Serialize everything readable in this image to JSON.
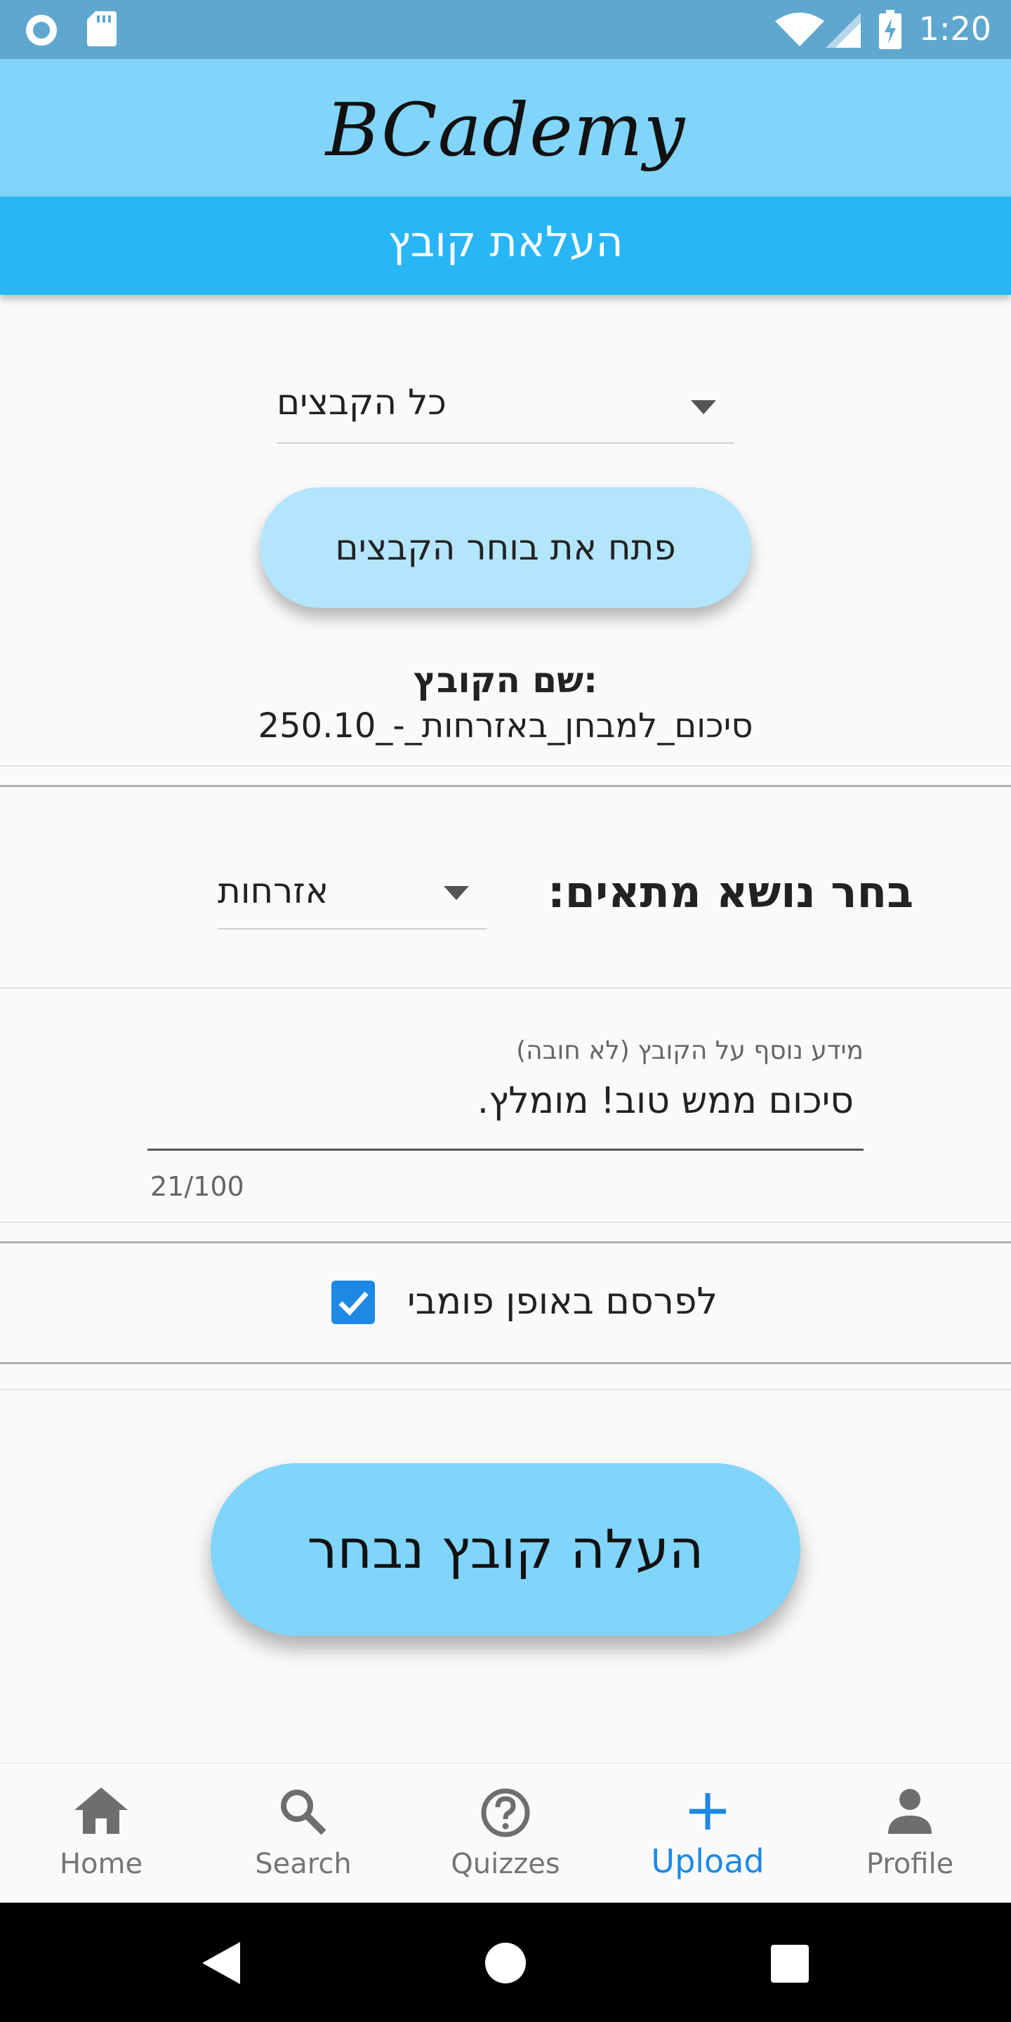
{
  "status_bar": {
    "time": "1:20"
  },
  "app_bar": {
    "title": "BCademy"
  },
  "page": {
    "title": "העלאת קובץ"
  },
  "file_filter": {
    "selected": "כל הקבצים"
  },
  "open_picker": {
    "label": "פתח את בוחר הקבצים"
  },
  "file_info": {
    "name_label": "שם הקובץ:",
    "name_value": "סיכום_למבחן_באזרחות_-_250.10"
  },
  "subject": {
    "label": "בחר נושא מתאים:",
    "selected": "אזרחות"
  },
  "extra_info": {
    "label": "מידע נוסף על הקובץ (לא חובה)",
    "value": "סיכום ממש טוב! מומלץ.",
    "counter": "21/100"
  },
  "publish": {
    "label": "לפרסם באופן פומבי",
    "checked": true
  },
  "upload": {
    "label": "העלה קובץ נבחר"
  },
  "bottom_nav": {
    "items": [
      {
        "label": "Home",
        "icon": "home-icon"
      },
      {
        "label": "Search",
        "icon": "search-icon"
      },
      {
        "label": "Quizzes",
        "icon": "help-circle-icon"
      },
      {
        "label": "Upload",
        "icon": "plus-icon",
        "active": true
      },
      {
        "label": "Profile",
        "icon": "person-icon"
      }
    ]
  },
  "colors": {
    "app_bar": "#81d4fa",
    "header": "#29b6f6",
    "accent": "#1e88e5",
    "status_bar": "#5fa7cf"
  }
}
